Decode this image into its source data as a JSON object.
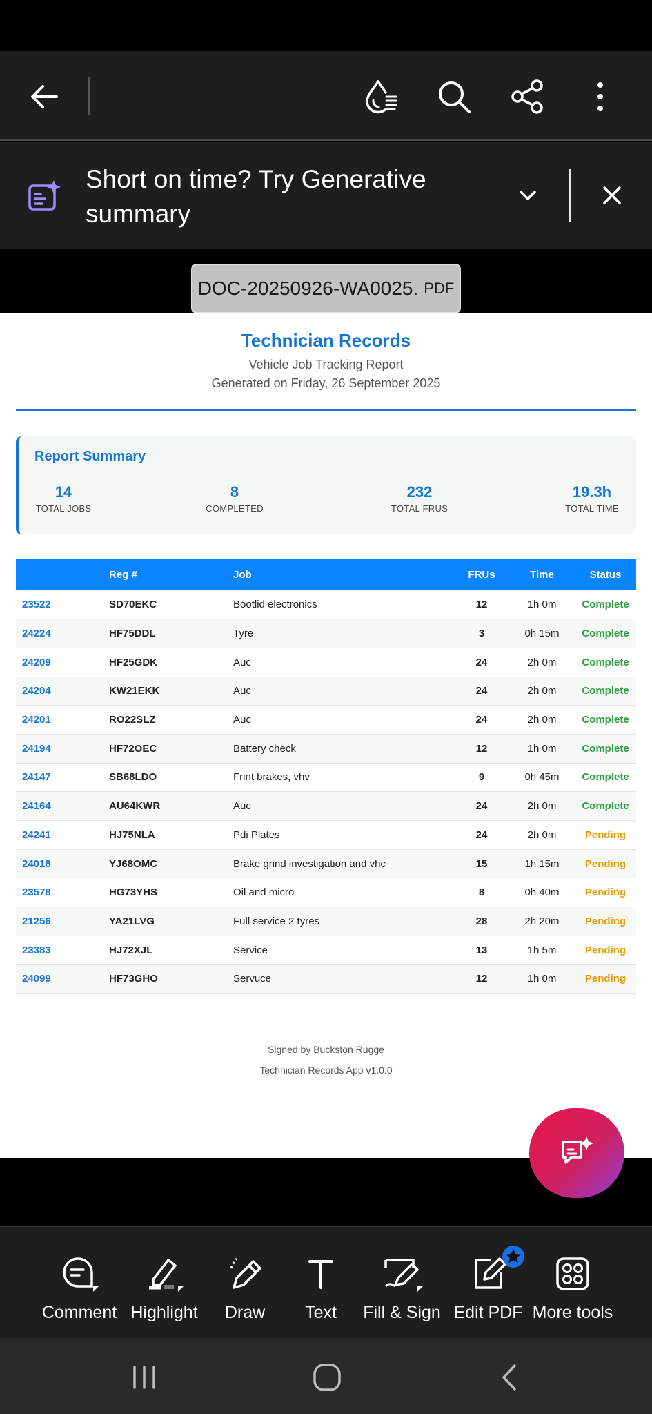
{
  "app": {
    "generative_prompt": "Short on time? Try Generative summary",
    "file_name": "DOC-20250926-WA0025.",
    "file_ext": "PDF"
  },
  "icons": {
    "back": "arrow-left-icon",
    "liquid_mode": "liquid-mode-icon",
    "search": "search-icon",
    "share": "share-icon",
    "more": "more-vertical-icon",
    "generative": "generative-summary-icon",
    "chevron": "chevron-down-icon",
    "close": "close-icon"
  },
  "document": {
    "title": "Technician Records",
    "subtitle": "Vehicle Job Tracking Report",
    "generated": "Generated on Friday, 26 September 2025",
    "summary": {
      "title": "Report Summary",
      "stats": [
        {
          "value": "14",
          "label": "TOTAL JOBS"
        },
        {
          "value": "8",
          "label": "COMPLETED"
        },
        {
          "value": "232",
          "label": "TOTAL FRUS"
        },
        {
          "value": "19.3h",
          "label": "TOTAL TIME"
        }
      ]
    },
    "table": {
      "headers": [
        "",
        "Reg #",
        "Job",
        "FRUs",
        "Time",
        "Status"
      ],
      "rows": [
        {
          "id": "23522",
          "reg": "SD70EKC",
          "job": "Bootlid electronics",
          "frus": "12",
          "time": "1h 0m",
          "status": "Complete"
        },
        {
          "id": "24224",
          "reg": "HF75DDL",
          "job": "Tyre",
          "frus": "3",
          "time": "0h 15m",
          "status": "Complete"
        },
        {
          "id": "24209",
          "reg": "HF25GDK",
          "job": "Auc",
          "frus": "24",
          "time": "2h 0m",
          "status": "Complete"
        },
        {
          "id": "24204",
          "reg": "KW21EKK",
          "job": "Auc",
          "frus": "24",
          "time": "2h 0m",
          "status": "Complete"
        },
        {
          "id": "24201",
          "reg": "RO22SLZ",
          "job": "Auc",
          "frus": "24",
          "time": "2h 0m",
          "status": "Complete"
        },
        {
          "id": "24194",
          "reg": "HF72OEC",
          "job": "Battery check",
          "frus": "12",
          "time": "1h 0m",
          "status": "Complete"
        },
        {
          "id": "24147",
          "reg": "SB68LDO",
          "job": "Frint brakes, vhv",
          "frus": "9",
          "time": "0h 45m",
          "status": "Complete"
        },
        {
          "id": "24164",
          "reg": "AU64KWR",
          "job": "Auc",
          "frus": "24",
          "time": "2h 0m",
          "status": "Complete"
        },
        {
          "id": "24241",
          "reg": "HJ75NLA",
          "job": "Pdi Plates",
          "frus": "24",
          "time": "2h 0m",
          "status": "Pending"
        },
        {
          "id": "24018",
          "reg": "YJ68OMC",
          "job": "Brake grind investigation and vhc",
          "frus": "15",
          "time": "1h 15m",
          "status": "Pending"
        },
        {
          "id": "23578",
          "reg": "HG73YHS",
          "job": "Oil and micro",
          "frus": "8",
          "time": "0h 40m",
          "status": "Pending"
        },
        {
          "id": "21256",
          "reg": "YA21LVG",
          "job": "Full service 2 tyres",
          "frus": "28",
          "time": "2h 20m",
          "status": "Pending"
        },
        {
          "id": "23383",
          "reg": "HJ72XJL",
          "job": "Service",
          "frus": "13",
          "time": "1h 5m",
          "status": "Pending"
        },
        {
          "id": "24099",
          "reg": "HF73GHO",
          "job": "Servuce",
          "frus": "12",
          "time": "1h 0m",
          "status": "Pending"
        }
      ]
    },
    "signed": "Signed by Buckston Rugge",
    "app_version": "Technician Records App v1.0.0"
  },
  "toolbar": {
    "items": [
      {
        "label": "Comment",
        "icon": "comment-icon"
      },
      {
        "label": "Highlight",
        "icon": "highlight-icon"
      },
      {
        "label": "Draw",
        "icon": "draw-icon"
      },
      {
        "label": "Text",
        "icon": "text-icon"
      },
      {
        "label": "Fill & Sign",
        "icon": "fill-sign-icon"
      },
      {
        "label": "Edit PDF",
        "icon": "edit-pdf-icon"
      },
      {
        "label": "More tools",
        "icon": "more-tools-icon"
      }
    ]
  },
  "colors": {
    "accent": "#1676d6",
    "header_blue": "#0a84ff",
    "complete": "#2ea043",
    "pending": "#e69a00"
  }
}
